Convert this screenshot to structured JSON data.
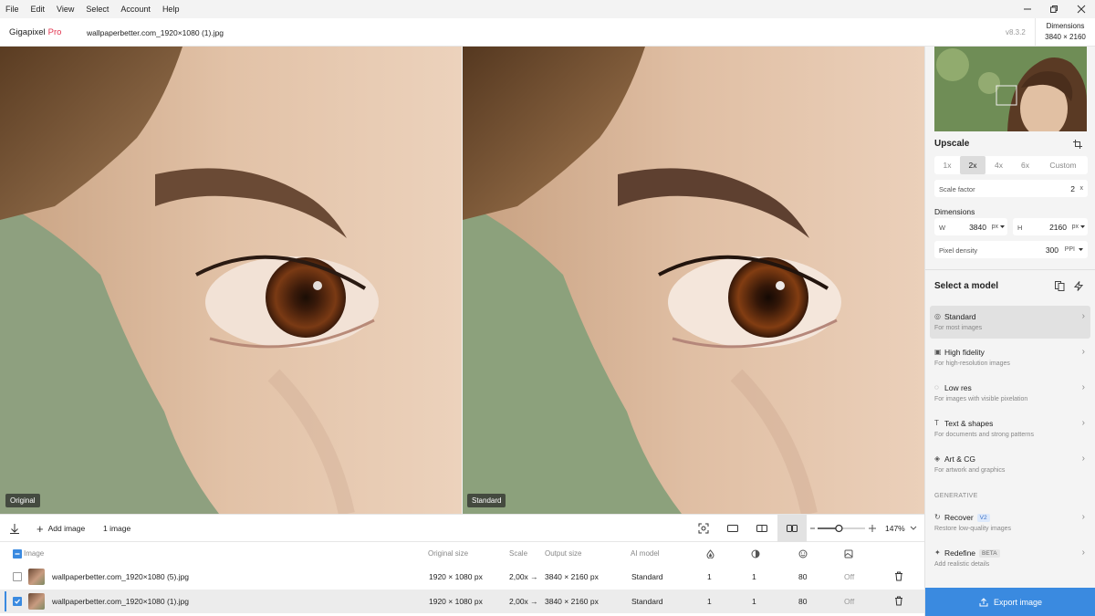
{
  "menu": [
    "File",
    "Edit",
    "View",
    "Select",
    "Account",
    "Help"
  ],
  "app": {
    "name": "Gigapixel",
    "tier": "Pro",
    "file_name": "wallpaperbetter.com_1920×1080 (1).jpg",
    "version": "v8.3.2"
  },
  "dimensions_box": {
    "label": "Dimensions",
    "value": "3840 × 2160"
  },
  "preview": {
    "left_label": "Original",
    "right_label": "Standard"
  },
  "toolbar": {
    "add_image_label": "Add image",
    "image_count": "1 image",
    "zoom": "147%",
    "zoom_level": 0.45
  },
  "table": {
    "headers": [
      "Image",
      "Original size",
      "Scale",
      "Output size",
      "AI model"
    ],
    "rows": [
      {
        "name": "wallpaperbetter.com_1920×1080 (5).jpg",
        "original_size": "1920 × 1080 px",
        "scale": "2,00x",
        "output_size": "3840 × 2160 px",
        "ai_model": "Standard",
        "col1": "1",
        "col2": "1",
        "col3": "80",
        "col4": "Off",
        "checked": false
      },
      {
        "name": "wallpaperbetter.com_1920×1080 (1).jpg",
        "original_size": "1920 × 1080 px",
        "scale": "2,00x",
        "output_size": "3840 × 2160 px",
        "ai_model": "Standard",
        "col1": "1",
        "col2": "1",
        "col3": "80",
        "col4": "Off",
        "checked": true
      }
    ]
  },
  "sidebar": {
    "upscale_title": "Upscale",
    "scale_options": [
      "1x",
      "2x",
      "4x",
      "6x",
      "Custom"
    ],
    "scale_selected": "2x",
    "scale_factor_label": "Scale factor",
    "scale_factor_value": "2",
    "scale_factor_unit": "x",
    "dimensions_title": "Dimensions",
    "width_label": "W",
    "width_value": "3840",
    "height_label": "H",
    "height_value": "2160",
    "dim_unit": "px",
    "pixel_density_label": "Pixel density",
    "pixel_density_value": "300",
    "pixel_density_unit": "PPI",
    "model_title": "Select a model",
    "models": [
      {
        "title": "Standard",
        "subtitle": "For most images",
        "icon": "◎",
        "active": true
      },
      {
        "title": "High fidelity",
        "subtitle": "For high-resolution images",
        "icon": "▣"
      },
      {
        "title": "Low res",
        "subtitle": "For images with visible pixelation",
        "icon": "◌"
      },
      {
        "title": "Text & shapes",
        "subtitle": "For documents and strong patterns",
        "icon": "T"
      },
      {
        "title": "Art & CG",
        "subtitle": "For artwork and graphics",
        "icon": "◈"
      }
    ],
    "generative_label": "GENERATIVE",
    "generative_models": [
      {
        "title": "Recover",
        "badge": "V2",
        "subtitle": "Restore low-quality images",
        "icon": "↻"
      },
      {
        "title": "Redefine",
        "badge": "BETA",
        "subtitle": "Add realistic details",
        "icon": "✦"
      }
    ],
    "export_label": "Export image"
  },
  "colors": {
    "accent": "#3a8ae0",
    "pro": "#e2344f",
    "sidebar_bg": "#f4f4f4"
  }
}
